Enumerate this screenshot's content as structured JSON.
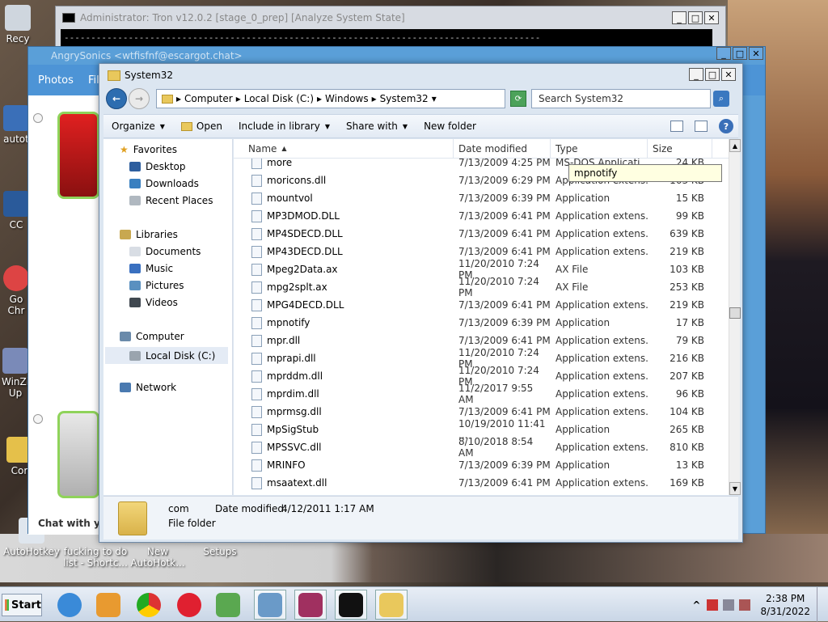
{
  "desktop": {
    "icons": [
      {
        "label": "Recy"
      },
      {
        "label": "autot"
      },
      {
        "label": "CC"
      },
      {
        "label": "Go\nChr"
      },
      {
        "label": "WinZi\nUp"
      },
      {
        "label": "Cor"
      },
      {
        "label": "AutoHotkey"
      },
      {
        "label": "fucking to do\nlist - Shortc..."
      },
      {
        "label": "New\nAutoHotk..."
      },
      {
        "label": "Setups"
      }
    ]
  },
  "console": {
    "title": "Administrator:  Tron v12.0.2 [stage_0_prep] [Analyze System State]",
    "line": "-----------------------------------------------------------------------------------------"
  },
  "angry": {
    "title": "AngrySonics <wtfisfnf@escargot.chat>",
    "nav_photos": "Photos",
    "nav_file": "Fil",
    "chat_label": "Chat with you"
  },
  "explorer": {
    "title": "System32",
    "breadcrumb": [
      "Computer",
      "Local Disk (C:)",
      "Windows",
      "System32"
    ],
    "search_placeholder": "Search System32",
    "commands": {
      "organize": "Organize",
      "open": "Open",
      "include": "Include in library",
      "share": "Share with",
      "newfolder": "New folder"
    },
    "nav": {
      "favorites": "Favorites",
      "desktop": "Desktop",
      "downloads": "Downloads",
      "recent": "Recent Places",
      "libraries": "Libraries",
      "documents": "Documents",
      "music": "Music",
      "pictures": "Pictures",
      "videos": "Videos",
      "computer": "Computer",
      "localdisk": "Local Disk (C:)",
      "network": "Network"
    },
    "columns": {
      "name": "Name",
      "date": "Date modified",
      "type": "Type",
      "size": "Size"
    },
    "files": [
      {
        "name": "more",
        "date": "7/13/2009 4:25 PM",
        "type": "MS-DOS Applicati...",
        "size": "24 KB"
      },
      {
        "name": "moricons.dll",
        "date": "7/13/2009 6:29 PM",
        "type": "Application extens...",
        "size": "163 KB"
      },
      {
        "name": "mountvol",
        "date": "7/13/2009 6:39 PM",
        "type": "Application",
        "size": "15 KB"
      },
      {
        "name": "MP3DMOD.DLL",
        "date": "7/13/2009 6:41 PM",
        "type": "Application extens...",
        "size": "99 KB"
      },
      {
        "name": "MP4SDECD.DLL",
        "date": "7/13/2009 6:41 PM",
        "type": "Application extens...",
        "size": "639 KB"
      },
      {
        "name": "MP43DECD.DLL",
        "date": "7/13/2009 6:41 PM",
        "type": "Application extens...",
        "size": "219 KB"
      },
      {
        "name": "Mpeg2Data.ax",
        "date": "11/20/2010 7:24 PM",
        "type": "AX File",
        "size": "103 KB"
      },
      {
        "name": "mpg2splt.ax",
        "date": "11/20/2010 7:24 PM",
        "type": "AX File",
        "size": "253 KB"
      },
      {
        "name": "MPG4DECD.DLL",
        "date": "7/13/2009 6:41 PM",
        "type": "Application extens...",
        "size": "219 KB"
      },
      {
        "name": "mpnotify",
        "date": "7/13/2009 6:39 PM",
        "type": "Application",
        "size": "17 KB"
      },
      {
        "name": "mpr.dll",
        "date": "7/13/2009 6:41 PM",
        "type": "Application extens...",
        "size": "79 KB"
      },
      {
        "name": "mprapi.dll",
        "date": "11/20/2010 7:24 PM",
        "type": "Application extens...",
        "size": "216 KB"
      },
      {
        "name": "mprddm.dll",
        "date": "11/20/2010 7:24 PM",
        "type": "Application extens...",
        "size": "207 KB"
      },
      {
        "name": "mprdim.dll",
        "date": "11/2/2017 9:55 AM",
        "type": "Application extens...",
        "size": "96 KB"
      },
      {
        "name": "mprmsg.dll",
        "date": "7/13/2009 6:41 PM",
        "type": "Application extens...",
        "size": "104 KB"
      },
      {
        "name": "MpSigStub",
        "date": "10/19/2010 11:41 ...",
        "type": "Application",
        "size": "265 KB"
      },
      {
        "name": "MPSSVC.dll",
        "date": "8/10/2018 8:54 AM",
        "type": "Application extens...",
        "size": "810 KB"
      },
      {
        "name": "MRINFO",
        "date": "7/13/2009 6:39 PM",
        "type": "Application",
        "size": "13 KB"
      },
      {
        "name": "msaatext.dll",
        "date": "7/13/2009 6:41 PM",
        "type": "Application extens...",
        "size": "169 KB"
      }
    ],
    "tooltip": "mpnotify",
    "details": {
      "name": "com",
      "date_label": "Date modified:",
      "date_value": "4/12/2011 1:17 AM",
      "kind": "File folder"
    }
  },
  "taskbar": {
    "start": "Start",
    "time": "2:38 PM",
    "date": "8/31/2022",
    "tray_arrow": "^"
  }
}
